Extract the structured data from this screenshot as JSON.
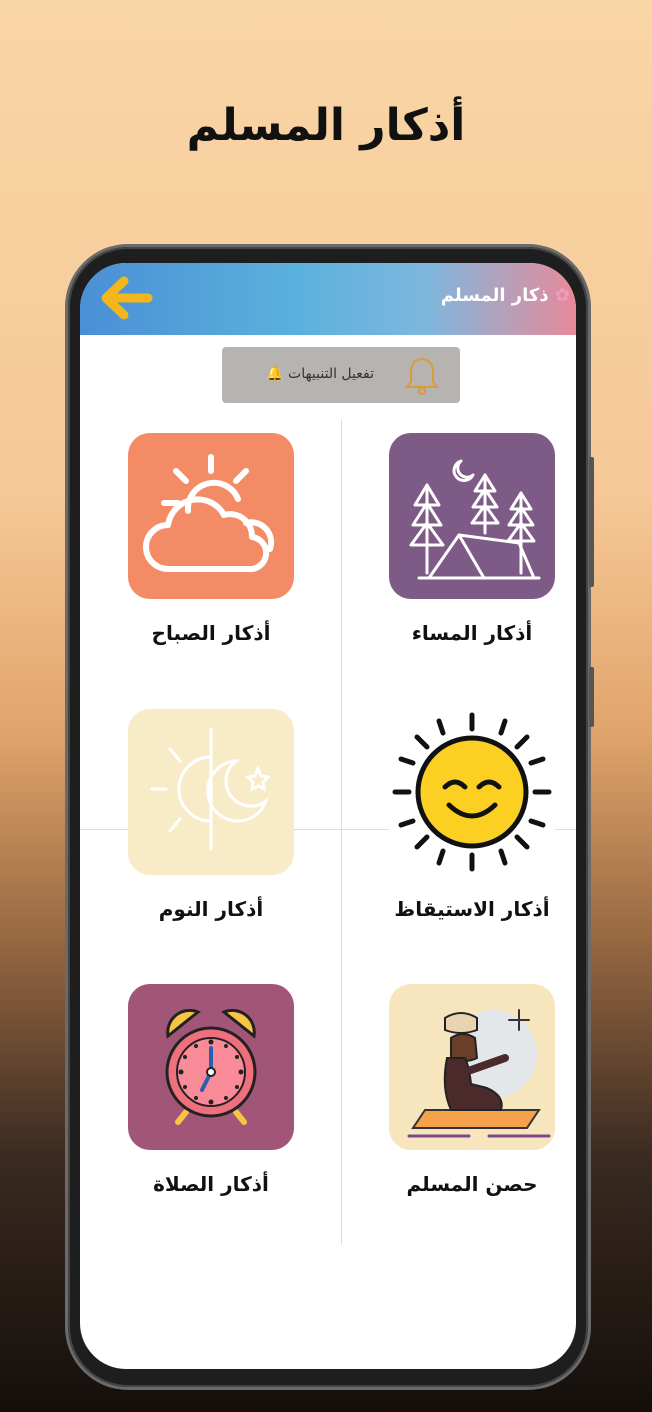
{
  "headline": "أذكار المسلم",
  "appbar": {
    "title": "ذكار المسلم",
    "title_icon": "flower-icon",
    "back_icon": "arrow-left-icon"
  },
  "notifications": {
    "label": "تفعيل التنبيهات",
    "icon": "bell-icon"
  },
  "cards": [
    {
      "id": "evening",
      "label": "أذكار المساء",
      "icon": "tent-moon-icon",
      "color": "#7e5a87"
    },
    {
      "id": "morning",
      "label": "أذكار الصباح",
      "icon": "sun-cloud-icon",
      "color": "#f38b67"
    },
    {
      "id": "wakeup",
      "label": "أذكار الاستيقاظ",
      "icon": "smiling-sun-icon",
      "color": "#ffffff"
    },
    {
      "id": "sleep",
      "label": "أذكار النوم",
      "icon": "moon-sun-icon",
      "color": "#f8ecc8"
    },
    {
      "id": "hisn",
      "label": "حصن المسلم",
      "icon": "praying-man-icon",
      "color": "#f7e6bd"
    },
    {
      "id": "prayer",
      "label": "أذكار الصلاة",
      "icon": "alarm-clock-icon",
      "color": "#a25677"
    }
  ],
  "colors": {
    "accent_arrow": "#f5b61c",
    "appbar_start": "#4a8fd6",
    "appbar_end": "#e88a9a"
  }
}
